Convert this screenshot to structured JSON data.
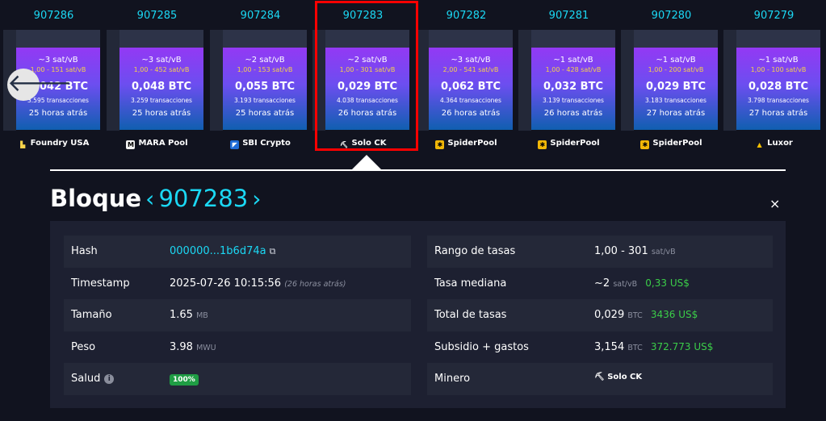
{
  "blocks": [
    {
      "height": "907286",
      "fee_span": "~3 sat/vB",
      "fee_range": "1,00 - 151 sat/vB",
      "total": "0,042 BTC",
      "tx": "3.595 transacciones",
      "time": "25 horas atrás",
      "pool": "Foundry USA",
      "pool_icon": "foundry-icon"
    },
    {
      "height": "907285",
      "fee_span": "~3 sat/vB",
      "fee_range": "1,00 - 452 sat/vB",
      "total": "0,048 BTC",
      "tx": "3.259 transacciones",
      "time": "25 horas atrás",
      "pool": "MARA Pool",
      "pool_icon": "mara-icon"
    },
    {
      "height": "907284",
      "fee_span": "~2 sat/vB",
      "fee_range": "1,00 - 153 sat/vB",
      "total": "0,055 BTC",
      "tx": "3.193 transacciones",
      "time": "25 horas atrás",
      "pool": "SBI Crypto",
      "pool_icon": "sbi-crypto-icon"
    },
    {
      "height": "907283",
      "fee_span": "~2 sat/vB",
      "fee_range": "1,00 - 301 sat/vB",
      "total": "0,029 BTC",
      "tx": "4.038 transacciones",
      "time": "26 horas atrás",
      "pool": "Solo CK",
      "pool_icon": "pickaxe-icon"
    },
    {
      "height": "907282",
      "fee_span": "~3 sat/vB",
      "fee_range": "2,00 - 541 sat/vB",
      "total": "0,062 BTC",
      "tx": "4.364 transacciones",
      "time": "26 horas atrás",
      "pool": "SpiderPool",
      "pool_icon": "spiderpool-icon"
    },
    {
      "height": "907281",
      "fee_span": "~1 sat/vB",
      "fee_range": "1,00 - 428 sat/vB",
      "total": "0,032 BTC",
      "tx": "3.139 transacciones",
      "time": "26 horas atrás",
      "pool": "SpiderPool",
      "pool_icon": "spiderpool-icon"
    },
    {
      "height": "907280",
      "fee_span": "~1 sat/vB",
      "fee_range": "1,00 - 200 sat/vB",
      "total": "0,029 BTC",
      "tx": "3.183 transacciones",
      "time": "27 horas atrás",
      "pool": "SpiderPool",
      "pool_icon": "spiderpool-icon"
    },
    {
      "height": "907279",
      "fee_span": "~1 sat/vB",
      "fee_range": "1,00 - 100 sat/vB",
      "total": "0,028 BTC",
      "tx": "3.798 transacciones",
      "time": "27 horas atrás",
      "pool": "Luxor",
      "pool_icon": "luxor-icon"
    }
  ],
  "detail": {
    "title": "Bloque",
    "height": "907283",
    "prev_chevron": "‹",
    "next_chevron": "›",
    "close": "×",
    "left": {
      "hash_label": "Hash",
      "hash_value": "000000...1b6d74a",
      "timestamp_label": "Timestamp",
      "timestamp_value": "2025-07-26 10:15:56",
      "timestamp_relative": "(26 horas atrás)",
      "size_label": "Tamaño",
      "size_value": "1.65",
      "size_unit": "MB",
      "weight_label": "Peso",
      "weight_value": "3.98",
      "weight_unit": "MWU",
      "health_label": "Salud",
      "health_value": "100%"
    },
    "right": {
      "fee_range_label": "Rango de tasas",
      "fee_range_value": "1,00 - 301",
      "fee_range_unit": "sat/vB",
      "median_label": "Tasa mediana",
      "median_value": "~2",
      "median_unit": "sat/vB",
      "median_usd": "0,33 US$",
      "total_fees_label": "Total de tasas",
      "total_fees_value": "0,029",
      "total_fees_unit": "BTC",
      "total_fees_usd": "3436 US$",
      "subsidy_label": "Subsidio + gastos",
      "subsidy_value": "3,154",
      "subsidy_unit": "BTC",
      "subsidy_usd": "372.773 US$",
      "miner_label": "Minero",
      "miner_value": "Solo CK"
    }
  },
  "colors": {
    "accent": "#1bd8f4",
    "usd_green": "#3bcd49",
    "fee_yellow": "#f6d24a",
    "selected_border": "#ff0000"
  }
}
